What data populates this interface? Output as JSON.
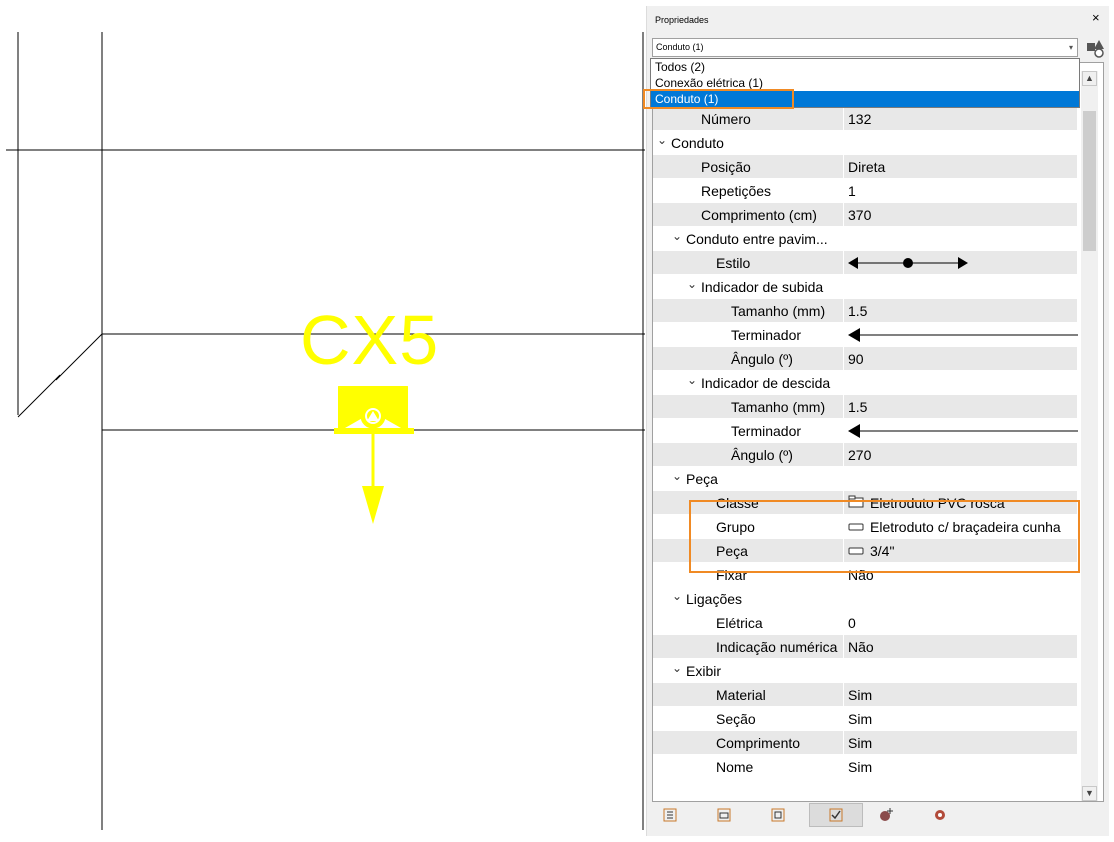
{
  "canvas": {
    "label": "CX5",
    "symbol_color": "#ffff00"
  },
  "panel": {
    "title": "Propriedades",
    "close": "×",
    "combo_value": "Conduto (1)",
    "combo_arrow": "▾",
    "dropdown": [
      {
        "label": "Todos (2)",
        "selected": false
      },
      {
        "label": "Conexão elétrica (1)",
        "selected": false
      },
      {
        "label": "Conduto (1)",
        "selected": true
      }
    ],
    "rows": [
      {
        "label": "Número",
        "value": "132"
      },
      {
        "label": "Conduto",
        "category": true
      },
      {
        "label": "Posição",
        "value": "Direta"
      },
      {
        "label": "Repetições",
        "value": "1"
      },
      {
        "label": "Comprimento (cm)",
        "value": "370"
      },
      {
        "label": "Conduto entre pavim...",
        "category": true
      },
      {
        "label": "Estilo",
        "value": ""
      },
      {
        "label": "Indicador de subida",
        "category": true
      },
      {
        "label": "Tamanho (mm)",
        "value": "1.5"
      },
      {
        "label": "Terminador",
        "value": ""
      },
      {
        "label": "Ângulo (º)",
        "value": "90"
      },
      {
        "label": "Indicador de descida",
        "category": true
      },
      {
        "label": "Tamanho (mm)",
        "value": "1.5"
      },
      {
        "label": "Terminador",
        "value": ""
      },
      {
        "label": "Ângulo (º)",
        "value": "270"
      },
      {
        "label": "Peça",
        "category": true
      },
      {
        "label": "Classe",
        "value": "Eletroduto PVC rosca"
      },
      {
        "label": "Grupo",
        "value": "Eletroduto c/ braçadeira cunha"
      },
      {
        "label": "Peça",
        "value": "3/4\""
      },
      {
        "label": "Fixar",
        "value": "Não"
      },
      {
        "label": "Ligações",
        "category": true
      },
      {
        "label": "Elétrica",
        "value": "0"
      },
      {
        "label": "Indicação numérica",
        "value": "Não"
      },
      {
        "label": "Exibir",
        "category": true
      },
      {
        "label": "Material",
        "value": "Sim"
      },
      {
        "label": "Seção",
        "value": "Sim"
      },
      {
        "label": "Comprimento",
        "value": "Sim"
      },
      {
        "label": "Nome",
        "value": "Sim"
      }
    ],
    "toolbar_icons": [
      "tree-view-icon",
      "window-icon",
      "list-icon",
      "properties-check-icon",
      "add-component-icon",
      "settings-gear-icon"
    ],
    "highlight_color": "#f08a24"
  }
}
